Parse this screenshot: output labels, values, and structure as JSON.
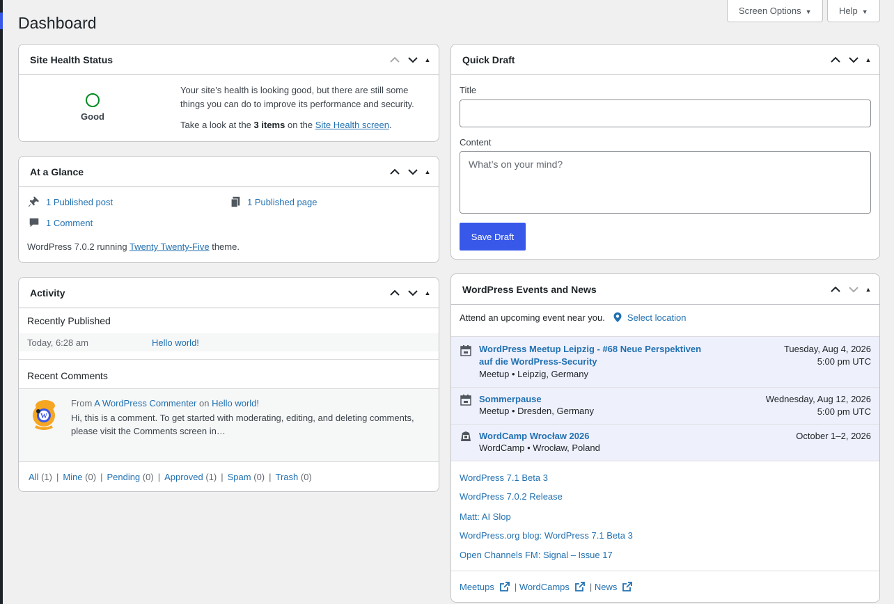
{
  "page": {
    "title": "Dashboard"
  },
  "top_buttons": {
    "screen_options": "Screen Options",
    "help": "Help"
  },
  "site_health": {
    "title": "Site Health Status",
    "status": "Good",
    "message": "Your site’s health is looking good, but there are still some things you can do to improve its performance and security.",
    "look_prefix": "Take a look at the",
    "items_count": "3 items",
    "look_mid": "on the",
    "link": "Site Health screen",
    "look_suffix": "."
  },
  "glance": {
    "title": "At a Glance",
    "posts": "1 Published post",
    "pages": "1 Published page",
    "comments": "1 Comment",
    "version_prefix": "WordPress 7.0.2 running",
    "theme": "Twenty Twenty-Five",
    "version_suffix": "theme."
  },
  "activity": {
    "title": "Activity",
    "recently_published": "Recently Published",
    "published_date": "Today, 6:28 am",
    "published_link": "Hello world!",
    "recent_comments": "Recent Comments",
    "comment_from": "From",
    "comment_author": "A WordPress Commenter",
    "comment_on": "on",
    "comment_post": "Hello world!",
    "comment_text": "Hi, this is a comment. To get started with moderating, editing, and deleting comments, please visit the Comments screen in…",
    "filters": [
      {
        "label": "All",
        "count": "(1)"
      },
      {
        "label": "Mine",
        "count": "(0)"
      },
      {
        "label": "Pending",
        "count": "(0)"
      },
      {
        "label": "Approved",
        "count": "(1)"
      },
      {
        "label": "Spam",
        "count": "(0)"
      },
      {
        "label": "Trash",
        "count": "(0)"
      }
    ]
  },
  "quick_draft": {
    "title": "Quick Draft",
    "title_label": "Title",
    "title_value": "",
    "content_label": "Content",
    "content_placeholder": "What’s on your mind?",
    "save_button": "Save Draft"
  },
  "events": {
    "title": "WordPress Events and News",
    "attend_text": "Attend an upcoming event near you.",
    "select_location": "Select location",
    "list": [
      {
        "title_line1": "WordPress Meetup Leipzig - #68 Neue Perspektiven",
        "title_line2": "auf die WordPress-Security",
        "meta": "Meetup • Leipzig, Germany",
        "date": "Tuesday, Aug 4, 2026",
        "time": "5:00 pm UTC",
        "icon": "calendar-icon"
      },
      {
        "title_line1": "Sommerpause",
        "title_line2": "",
        "meta": "Meetup • Dresden, Germany",
        "date": "Wednesday, Aug 12, 2026",
        "time": "5:00 pm UTC",
        "icon": "calendar-icon"
      },
      {
        "title_line1": "WordCamp Wrocław 2026",
        "title_line2": "",
        "meta": "WordCamp • Wrocław, Poland",
        "date": "October 1–2, 2026",
        "time": "",
        "icon": "wordcamp-icon"
      }
    ],
    "news": [
      "WordPress 7.1 Beta 3",
      "WordPress 7.0.2 Release",
      "Matt: AI Slop",
      "WordPress.org blog: WordPress 7.1 Beta 3",
      "Open Channels FM: Signal – Issue 17"
    ],
    "footer": {
      "meetups": "Meetups",
      "wordcamps": "WordCamps",
      "news": "News",
      "separator": "|"
    }
  },
  "colors": {
    "accent": "#3858e9",
    "link": "#2271b1",
    "good": "#008a20",
    "event_bg": "#eef0fc"
  }
}
